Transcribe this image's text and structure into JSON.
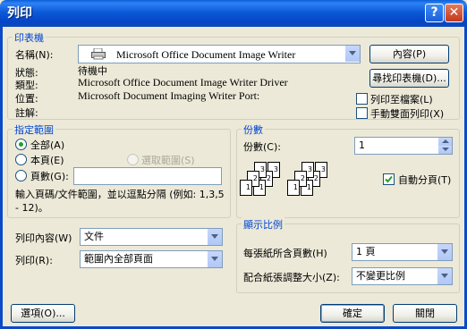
{
  "window": {
    "title": "列印",
    "help_glyph": "?",
    "close_glyph": "✕"
  },
  "printer": {
    "group_title": "印表機",
    "name_label": "名稱(N):",
    "name_value": "Microsoft Office Document Image Writer",
    "properties_button": "內容(P)",
    "find_printer_button": "尋找印表機(D)...",
    "status_label": "狀態:",
    "status_value": "待機中",
    "type_label": "類型:",
    "type_value": "Microsoft Office Document Image Writer Driver",
    "where_label": "位置:",
    "where_value": "Microsoft Document Imaging Writer Port:",
    "comment_label": "註解:",
    "print_to_file_label": "列印至檔案(L)",
    "manual_duplex_label": "手動雙面列印(X)"
  },
  "page_range": {
    "group_title": "指定範圍",
    "all_label": "全部(A)",
    "current_page_label": "本頁(E)",
    "selection_label": "選取範圍(S)",
    "pages_label": "頁數(G):",
    "pages_value": "",
    "hint": "輸入頁碼/文件範圍，並以逗點分隔 (例如: 1,3,5 - 12)。"
  },
  "copies": {
    "group_title": "份數",
    "number_label": "份數(C):",
    "number_value": "1",
    "collate_label": "自動分頁(T)",
    "collate_checked": true
  },
  "print_what": {
    "label": "列印內容(W)",
    "value": "文件"
  },
  "print": {
    "label": "列印(R):",
    "value": "範圍內全部頁面"
  },
  "zoom": {
    "group_title": "顯示比例",
    "pages_per_sheet_label": "每張紙所含頁數(H)",
    "pages_per_sheet_value": "1 頁",
    "scale_label": "配合紙張調整大小(Z):",
    "scale_value": "不變更比例"
  },
  "footer": {
    "options_button": "選項(O)...",
    "ok_button": "確定",
    "close_button": "關閉"
  }
}
